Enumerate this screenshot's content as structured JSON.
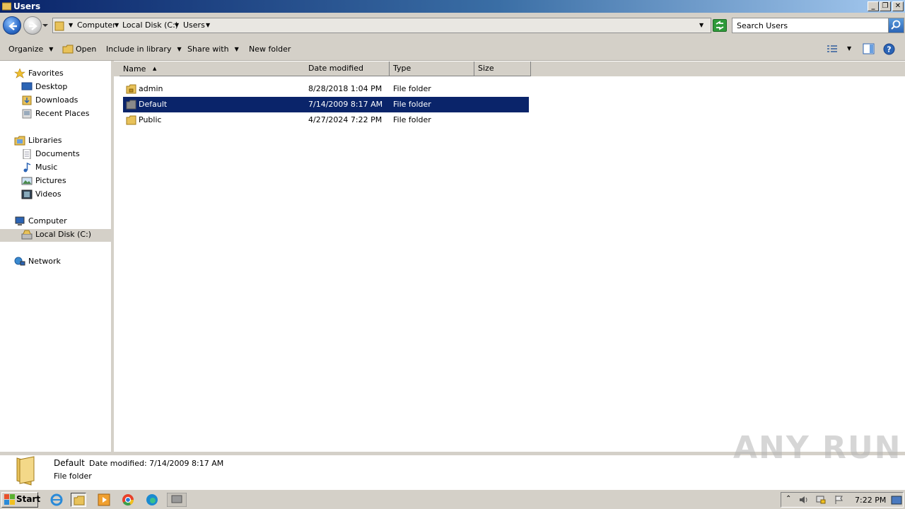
{
  "window": {
    "title": "Users",
    "minimize_label": "_",
    "restore_label": "❐",
    "close_label": "✕"
  },
  "address": {
    "crumbs": [
      "Computer",
      "Local Disk (C:)",
      "Users"
    ],
    "search_placeholder": "Search Users"
  },
  "toolbar": {
    "organize": "Organize",
    "open": "Open",
    "include_in_library": "Include in library",
    "share_with": "Share with",
    "new_folder": "New folder"
  },
  "nav": {
    "favorites": "Favorites",
    "desktop": "Desktop",
    "downloads": "Downloads",
    "recent_places": "Recent Places",
    "libraries": "Libraries",
    "documents": "Documents",
    "music": "Music",
    "pictures": "Pictures",
    "videos": "Videos",
    "computer": "Computer",
    "local_disk": "Local Disk (C:)",
    "network": "Network"
  },
  "columns": {
    "name": "Name",
    "date_modified": "Date modified",
    "type": "Type",
    "size": "Size"
  },
  "files": [
    {
      "name": "admin",
      "date": "8/28/2018 1:04 PM",
      "type": "File folder",
      "size": ""
    },
    {
      "name": "Default",
      "date": "7/14/2009 8:17 AM",
      "type": "File folder",
      "size": ""
    },
    {
      "name": "Public",
      "date": "4/27/2024 7:22 PM",
      "type": "File folder",
      "size": ""
    }
  ],
  "details": {
    "name": "Default",
    "modified": "Date modified: 7/14/2009 8:17 AM",
    "type": "File folder"
  },
  "watermark": "ANY RUN",
  "taskbar": {
    "start": "Start",
    "clock": "7:22 PM"
  },
  "colors": {
    "selection": "#0a246a",
    "chrome": "#d4d0c8",
    "folder": "#e8c25a"
  }
}
